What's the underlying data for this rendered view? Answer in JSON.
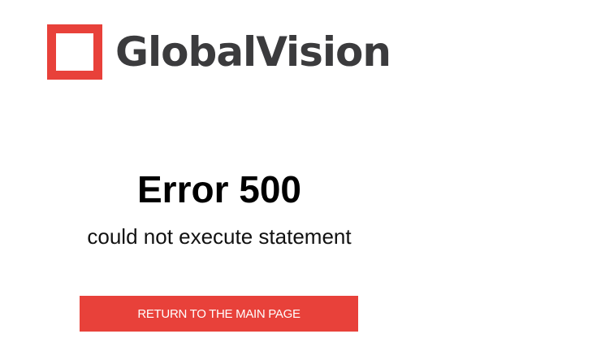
{
  "brand": {
    "name": "GlobalVision",
    "logo_icon": "red-square-outline-icon",
    "accent_color": "#e8413a",
    "text_color": "#3b3b3d"
  },
  "error": {
    "title": "Error 500",
    "message": "could not execute statement"
  },
  "actions": {
    "return_label": "RETURN TO THE MAIN PAGE"
  }
}
